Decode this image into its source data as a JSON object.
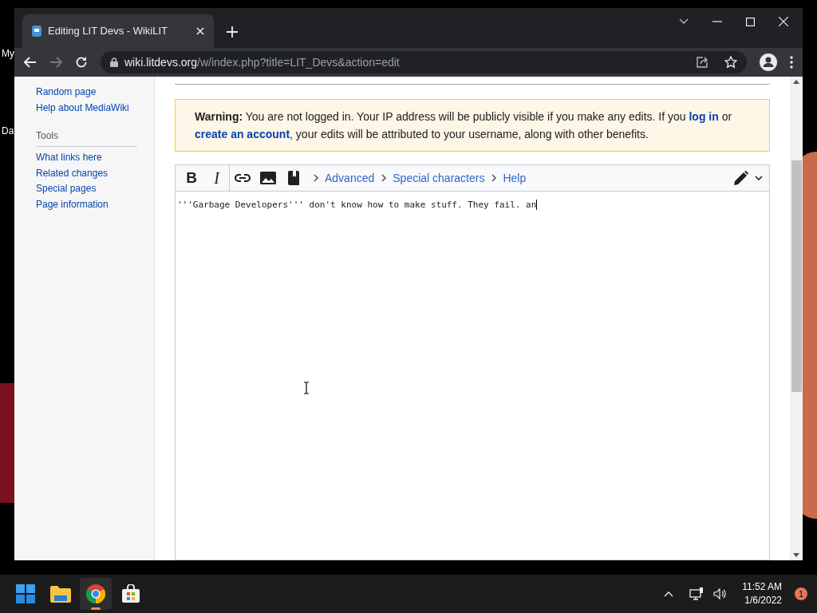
{
  "desktop_icons": [
    {
      "label": "My"
    },
    {
      "label": "Da"
    }
  ],
  "browser": {
    "tab": {
      "title": "Editing LIT Devs - WikiLIT",
      "selected": true
    },
    "url": {
      "domain": "wiki.litdevs.org",
      "path": "/w/index.php?title=LIT_Devs&action=edit"
    }
  },
  "sidebar": {
    "items": [
      {
        "label": "Random page"
      },
      {
        "label": "Help about MediaWiki"
      }
    ],
    "tools": {
      "heading": "Tools",
      "items": [
        {
          "label": "What links here"
        },
        {
          "label": "Related changes"
        },
        {
          "label": "Special pages"
        },
        {
          "label": "Page information"
        }
      ]
    }
  },
  "warning": {
    "text": "**Warning:** You are not logged in. Your IP address will be publicly visible if you make any edits. If you ",
    "login_link": "log in",
    "mid": " or ",
    "account_link": "create an account",
    "tail": ", your edits will be attributed to your username, along with other benefits."
  },
  "editor": {
    "tools": [
      {
        "kind": "bold",
        "label": "B"
      },
      {
        "kind": "italic",
        "label": "I"
      },
      {
        "kind": "link"
      },
      {
        "kind": "image"
      },
      {
        "kind": "reference"
      }
    ],
    "menus": [
      {
        "label": "Advanced",
        "expanded": false
      },
      {
        "label": "Special characters",
        "expanded": false
      },
      {
        "label": "Help",
        "expanded": false
      }
    ],
    "text": "'''Garbage Developers''' don't know how to make stuff. They fail. an"
  },
  "taskbar": {
    "apps": [
      {
        "kind": "start",
        "selected": false
      },
      {
        "kind": "files",
        "selected": false
      },
      {
        "kind": "browser",
        "selected": true
      },
      {
        "kind": "store",
        "selected": false
      }
    ],
    "time": "11:52 AM",
    "date": "1/6/2022",
    "notifications": "1"
  }
}
